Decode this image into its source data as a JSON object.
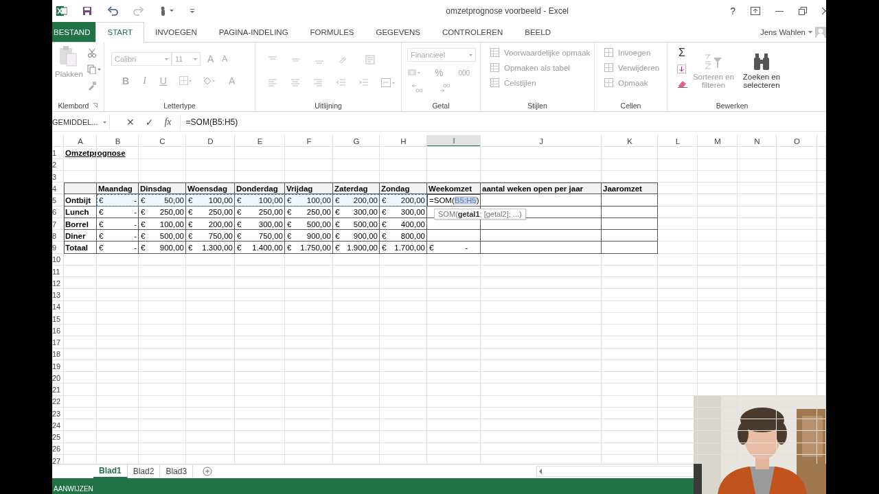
{
  "window": {
    "title": "omzetprognose voorbeeld - Excel",
    "help": "?",
    "user": "Jens Wahlen"
  },
  "ribbon_tabs": [
    {
      "label": "BESTAND",
      "kind": "file",
      "selected": false
    },
    {
      "label": "START",
      "kind": "tab",
      "selected": true
    },
    {
      "label": "INVOEGEN",
      "kind": "tab",
      "selected": false
    },
    {
      "label": "PAGINA-INDELING",
      "kind": "tab",
      "selected": false
    },
    {
      "label": "FORMULES",
      "kind": "tab",
      "selected": false
    },
    {
      "label": "GEGEVENS",
      "kind": "tab",
      "selected": false
    },
    {
      "label": "CONTROLEREN",
      "kind": "tab",
      "selected": false
    },
    {
      "label": "BEELD",
      "kind": "tab",
      "selected": false
    }
  ],
  "ribbon": {
    "clipboard": {
      "label": "Klembord",
      "paste": "Plakken"
    },
    "font": {
      "label": "Lettertype",
      "font_name": "Calibri",
      "font_size": "11",
      "grow": "A",
      "shrink": "A",
      "bold": "B",
      "italic": "I",
      "underline": "U",
      "font_color": "A"
    },
    "alignment": {
      "label": "Uitlijning"
    },
    "number": {
      "label": "Getal",
      "format": "Financieel",
      "percent": "%",
      "thousands": "000"
    },
    "styles": {
      "label": "Stijlen",
      "items": [
        "Voorwaardelijke opmaak",
        "Opmaken als tabel",
        "Celstijlen"
      ]
    },
    "cells": {
      "label": "Cellen",
      "items": [
        "Invoegen",
        "Verwijderen",
        "Opmaak"
      ]
    },
    "editing": {
      "label": "Bewerken",
      "autosum": "Σ",
      "sort": "Sorteren en filteren",
      "find": "Zoeken en selecteren"
    }
  },
  "formula_bar": {
    "name_box": "GEMIDDEL...",
    "cancel": "✕",
    "enter": "✓",
    "fx": "fx",
    "formula": "=SOM(B5:H5)"
  },
  "sheet": {
    "columns": [
      {
        "label": "A",
        "selected": false
      },
      {
        "label": "B",
        "selected": false
      },
      {
        "label": "C",
        "selected": false
      },
      {
        "label": "D",
        "selected": false
      },
      {
        "label": "E",
        "selected": false
      },
      {
        "label": "F",
        "selected": false
      },
      {
        "label": "G",
        "selected": false
      },
      {
        "label": "H",
        "selected": false
      },
      {
        "label": "I",
        "selected": true
      },
      {
        "label": "J",
        "selected": false
      },
      {
        "label": "K",
        "selected": false
      },
      {
        "label": "L",
        "selected": false
      },
      {
        "label": "M",
        "selected": false
      },
      {
        "label": "N",
        "selected": false
      },
      {
        "label": "O",
        "selected": false
      }
    ],
    "row_numbers": [
      "1",
      "2",
      "3",
      "4",
      "5",
      "6",
      "7",
      "8",
      "9",
      "10",
      "11",
      "12",
      "13",
      "14",
      "15",
      "16",
      "17",
      "18",
      "19",
      "20",
      "21",
      "22",
      "23",
      "24",
      "25",
      "26",
      "27"
    ],
    "title": "Omzetprognose",
    "table": {
      "headers": [
        "Maandag",
        "Dinsdag",
        "Woensdag",
        "Donderdag",
        "Vrijdag",
        "Zaterdag",
        "Zondag",
        "Weekomzet",
        "aantal weken open per jaar",
        "Jaaromzet"
      ],
      "rows": [
        {
          "label": "Ontbijt",
          "highlighted": true,
          "cells": [
            {
              "symbol": "€",
              "amount": "-"
            },
            {
              "symbol": "€",
              "amount": "50,00"
            },
            {
              "symbol": "€",
              "amount": "100,00"
            },
            {
              "symbol": "€",
              "amount": "100,00"
            },
            {
              "symbol": "€",
              "amount": "100,00"
            },
            {
              "symbol": "€",
              "amount": "200,00"
            },
            {
              "symbol": "€",
              "amount": "200,00"
            }
          ],
          "weekomzet": {
            "kind": "editing",
            "before": "=SOM(",
            "reference": "B5:H5",
            "after": ")",
            "tooltip": "SOM(**getal1**; [getal2]; ...)"
          }
        },
        {
          "label": "Lunch",
          "highlighted": false,
          "cells": [
            {
              "symbol": "€",
              "amount": "-"
            },
            {
              "symbol": "€",
              "amount": "250,00"
            },
            {
              "symbol": "€",
              "amount": "250,00"
            },
            {
              "symbol": "€",
              "amount": "250,00"
            },
            {
              "symbol": "€",
              "amount": "250,00"
            },
            {
              "symbol": "€",
              "amount": "300,00"
            },
            {
              "symbol": "€",
              "amount": "300,00"
            }
          ]
        },
        {
          "label": "Borrel",
          "highlighted": false,
          "cells": [
            {
              "symbol": "€",
              "amount": "-"
            },
            {
              "symbol": "€",
              "amount": "100,00"
            },
            {
              "symbol": "€",
              "amount": "200,00"
            },
            {
              "symbol": "€",
              "amount": "300,00"
            },
            {
              "symbol": "€",
              "amount": "500,00"
            },
            {
              "symbol": "€",
              "amount": "500,00"
            },
            {
              "symbol": "€",
              "amount": "400,00"
            }
          ]
        },
        {
          "label": "Diner",
          "highlighted": false,
          "cells": [
            {
              "symbol": "€",
              "amount": "-"
            },
            {
              "symbol": "€",
              "amount": "500,00"
            },
            {
              "symbol": "€",
              "amount": "750,00"
            },
            {
              "symbol": "€",
              "amount": "750,00"
            },
            {
              "symbol": "€",
              "amount": "900,00"
            },
            {
              "symbol": "€",
              "amount": "900,00"
            },
            {
              "symbol": "€",
              "amount": "800,00"
            }
          ]
        },
        {
          "label": "Totaal",
          "highlighted": false,
          "cells": [
            {
              "symbol": "€",
              "amount": "-"
            },
            {
              "symbol": "€",
              "amount": "900,00"
            },
            {
              "symbol": "€",
              "amount": "1.300,00"
            },
            {
              "symbol": "€",
              "amount": "1.400,00"
            },
            {
              "symbol": "€",
              "amount": "1.750,00"
            },
            {
              "symbol": "€",
              "amount": "1.900,00"
            },
            {
              "symbol": "€",
              "amount": "1.700,00"
            }
          ],
          "weekomzet": {
            "kind": "currency",
            "symbol": "€",
            "amount": "-"
          }
        }
      ]
    }
  },
  "sheet_tabs": [
    {
      "label": "Blad1",
      "selected": true
    },
    {
      "label": "Blad2",
      "selected": false
    },
    {
      "label": "Blad3",
      "selected": false
    }
  ],
  "status_bar": {
    "mode": "AANWIJZEN"
  }
}
